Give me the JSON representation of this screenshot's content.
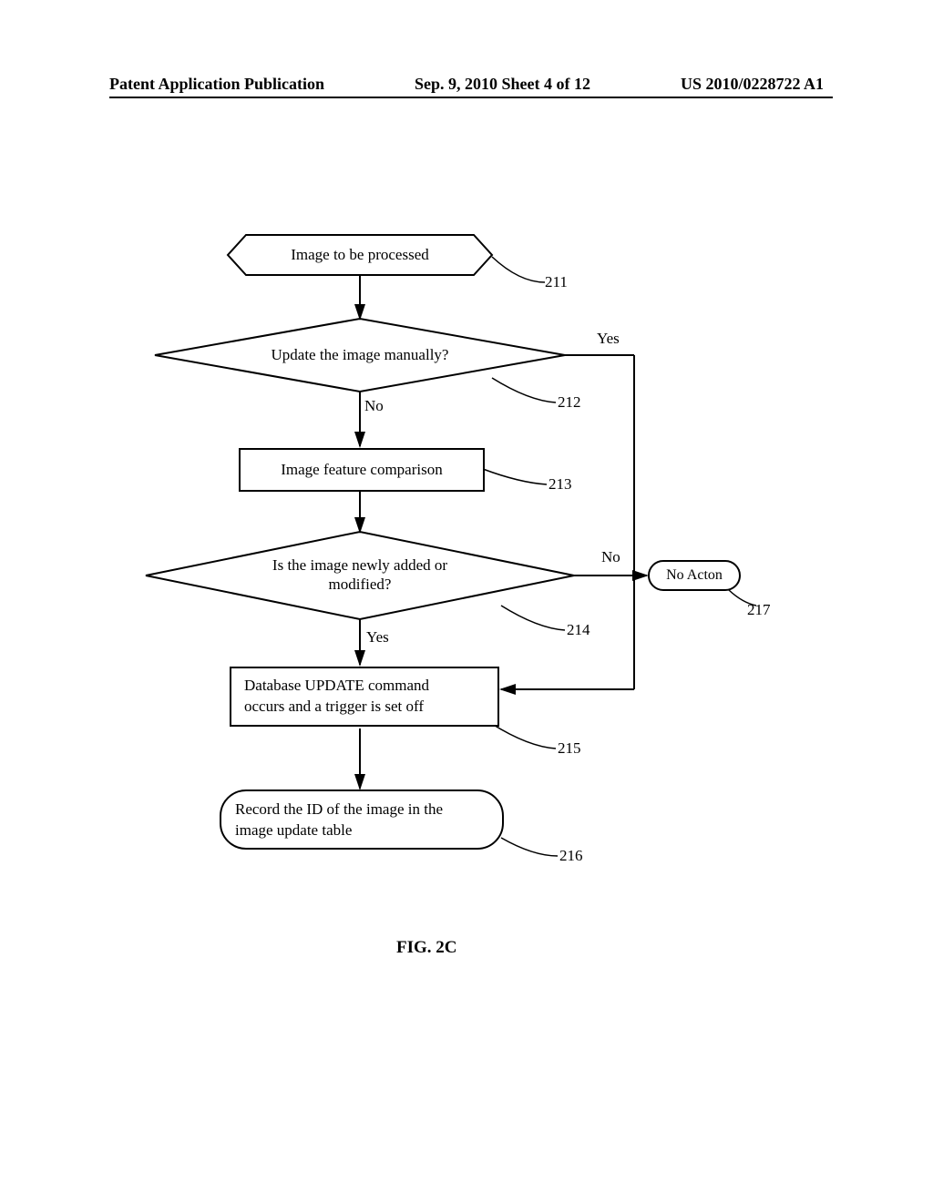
{
  "header": {
    "left": "Patent Application Publication",
    "center": "Sep. 9, 2010  Sheet 4 of 12",
    "right": "US 2010/0228722 A1"
  },
  "diagram": {
    "hex_start": "Image to be processed",
    "decision1": "Update the image manually?",
    "dec1_yes": "Yes",
    "dec1_no": "No",
    "process1": "Image feature comparison",
    "decision2_line1": "Is the image newly added or",
    "decision2_line2": "modified?",
    "dec2_no": "No",
    "dec2_yes": "Yes",
    "terminal_noaction": "No Acton",
    "process2_line1": "Database UPDATE command",
    "process2_line2": "occurs and a trigger is set off",
    "terminal_record_line1": "Record the ID of the image in the",
    "terminal_record_line2": "image update table",
    "ref_211": "211",
    "ref_212": "212",
    "ref_213": "213",
    "ref_214": "214",
    "ref_215": "215",
    "ref_216": "216",
    "ref_217": "217",
    "caption": "FIG. 2C"
  }
}
